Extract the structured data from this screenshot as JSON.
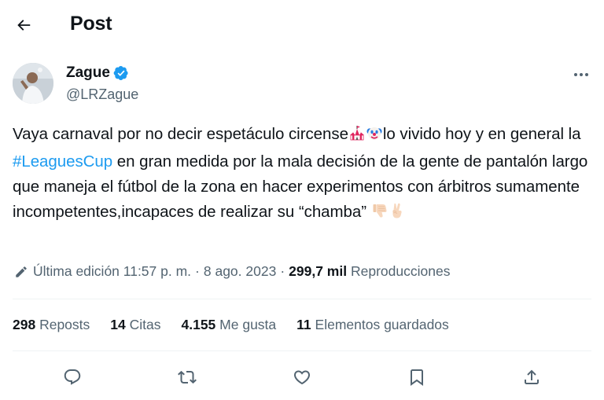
{
  "header": {
    "title": "Post",
    "back_icon": "arrow-left-icon"
  },
  "author": {
    "name": "Zague",
    "handle": "@LRZague",
    "verified_color": "#1d9bf0"
  },
  "tweet": {
    "part1": "Vaya carnaval por no decir espetáculo circense",
    "part2": "lo vivido hoy y en general la ",
    "hashtag": "#LeaguesCup",
    "part3": " en gran medida  por la mala decisión de la gente de pantalón largo que maneja el fútbol de la zona en hacer experimentos con árbitros sumamente incompetentes,incapaces de realizar su “chamba” ",
    "emojis": [
      "circus-tent-icon",
      "clown-face-icon",
      "thumbs-down-icon",
      "victory-hand-icon"
    ]
  },
  "meta": {
    "edited_label": "Última edición",
    "time": "11:57 p. m.",
    "date": "8 ago. 2023",
    "views": "299,7 mil",
    "views_label": "Reproducciones"
  },
  "stats": {
    "reposts": "298",
    "reposts_label": "Reposts",
    "quotes": "14",
    "quotes_label": "Citas",
    "likes": "4.155",
    "likes_label": "Me gusta",
    "bookmarks": "11",
    "bookmarks_label": "Elementos guardados"
  },
  "actions": [
    "reply-icon",
    "repost-icon",
    "like-icon",
    "bookmark-icon",
    "share-icon"
  ],
  "colors": {
    "accent": "#1d9bf0",
    "text": "#0f1419",
    "secondary": "#536471",
    "divider": "#eff3f4"
  }
}
